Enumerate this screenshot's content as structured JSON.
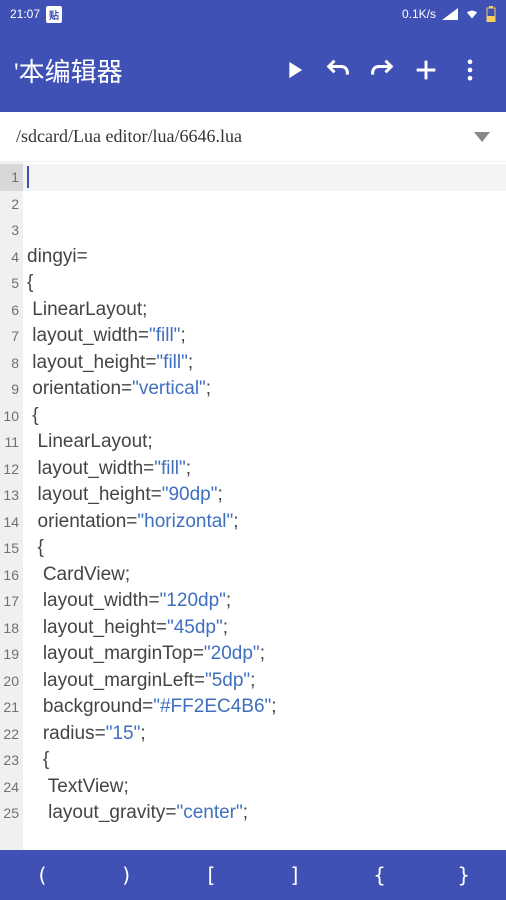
{
  "status": {
    "time": "21:07",
    "badge": "贴",
    "net": "0.1K/s"
  },
  "appbar": {
    "title": "'本编辑器"
  },
  "path": "/sdcard/Lua editor/lua/6646.lua",
  "lines": [
    {
      "n": 1,
      "seg": [
        {
          "t": ""
        }
      ]
    },
    {
      "n": 2,
      "seg": [
        {
          "t": ""
        }
      ]
    },
    {
      "n": 3,
      "seg": [
        {
          "t": ""
        }
      ]
    },
    {
      "n": 4,
      "seg": [
        {
          "t": "dingyi="
        }
      ]
    },
    {
      "n": 5,
      "seg": [
        {
          "t": "{"
        }
      ]
    },
    {
      "n": 6,
      "seg": [
        {
          "t": " LinearLayout;"
        }
      ]
    },
    {
      "n": 7,
      "seg": [
        {
          "t": " layout_width="
        },
        {
          "t": "\"fill\"",
          "c": "str"
        },
        {
          "t": ";"
        }
      ]
    },
    {
      "n": 8,
      "seg": [
        {
          "t": " layout_height="
        },
        {
          "t": "\"fill\"",
          "c": "str"
        },
        {
          "t": ";"
        }
      ]
    },
    {
      "n": 9,
      "seg": [
        {
          "t": " orientation="
        },
        {
          "t": "\"vertical\"",
          "c": "str"
        },
        {
          "t": ";"
        }
      ]
    },
    {
      "n": 10,
      "seg": [
        {
          "t": " {"
        }
      ]
    },
    {
      "n": 11,
      "seg": [
        {
          "t": "  LinearLayout;"
        }
      ]
    },
    {
      "n": 12,
      "seg": [
        {
          "t": "  layout_width="
        },
        {
          "t": "\"fill\"",
          "c": "str"
        },
        {
          "t": ";"
        }
      ]
    },
    {
      "n": 13,
      "seg": [
        {
          "t": "  layout_height="
        },
        {
          "t": "\"90dp\"",
          "c": "str"
        },
        {
          "t": ";"
        }
      ]
    },
    {
      "n": 14,
      "seg": [
        {
          "t": "  orientation="
        },
        {
          "t": "\"horizontal\"",
          "c": "str"
        },
        {
          "t": ";"
        }
      ]
    },
    {
      "n": 15,
      "seg": [
        {
          "t": "  {"
        }
      ]
    },
    {
      "n": 16,
      "seg": [
        {
          "t": "   CardView;"
        }
      ]
    },
    {
      "n": 17,
      "seg": [
        {
          "t": "   layout_width="
        },
        {
          "t": "\"120dp\"",
          "c": "str"
        },
        {
          "t": ";"
        }
      ]
    },
    {
      "n": 18,
      "seg": [
        {
          "t": "   layout_height="
        },
        {
          "t": "\"45dp\"",
          "c": "str"
        },
        {
          "t": ";"
        }
      ]
    },
    {
      "n": 19,
      "seg": [
        {
          "t": "   layout_marginTop="
        },
        {
          "t": "\"20dp\"",
          "c": "str"
        },
        {
          "t": ";"
        }
      ]
    },
    {
      "n": 20,
      "seg": [
        {
          "t": "   layout_marginLeft="
        },
        {
          "t": "\"5dp\"",
          "c": "str"
        },
        {
          "t": ";"
        }
      ]
    },
    {
      "n": 21,
      "seg": [
        {
          "t": "   background="
        },
        {
          "t": "\"#FF2EC4B6\"",
          "c": "str"
        },
        {
          "t": ";"
        }
      ]
    },
    {
      "n": 22,
      "seg": [
        {
          "t": "   radius="
        },
        {
          "t": "\"15\"",
          "c": "str"
        },
        {
          "t": ";"
        }
      ]
    },
    {
      "n": 23,
      "seg": [
        {
          "t": "   {"
        }
      ]
    },
    {
      "n": 24,
      "seg": [
        {
          "t": "    TextView;"
        }
      ]
    },
    {
      "n": 25,
      "seg": [
        {
          "t": "    layout_gravity="
        },
        {
          "t": "\"center\"",
          "c": "str"
        },
        {
          "t": ";"
        }
      ]
    }
  ],
  "toolbar": [
    "(",
    ")",
    "[",
    "]",
    "{",
    "}"
  ]
}
